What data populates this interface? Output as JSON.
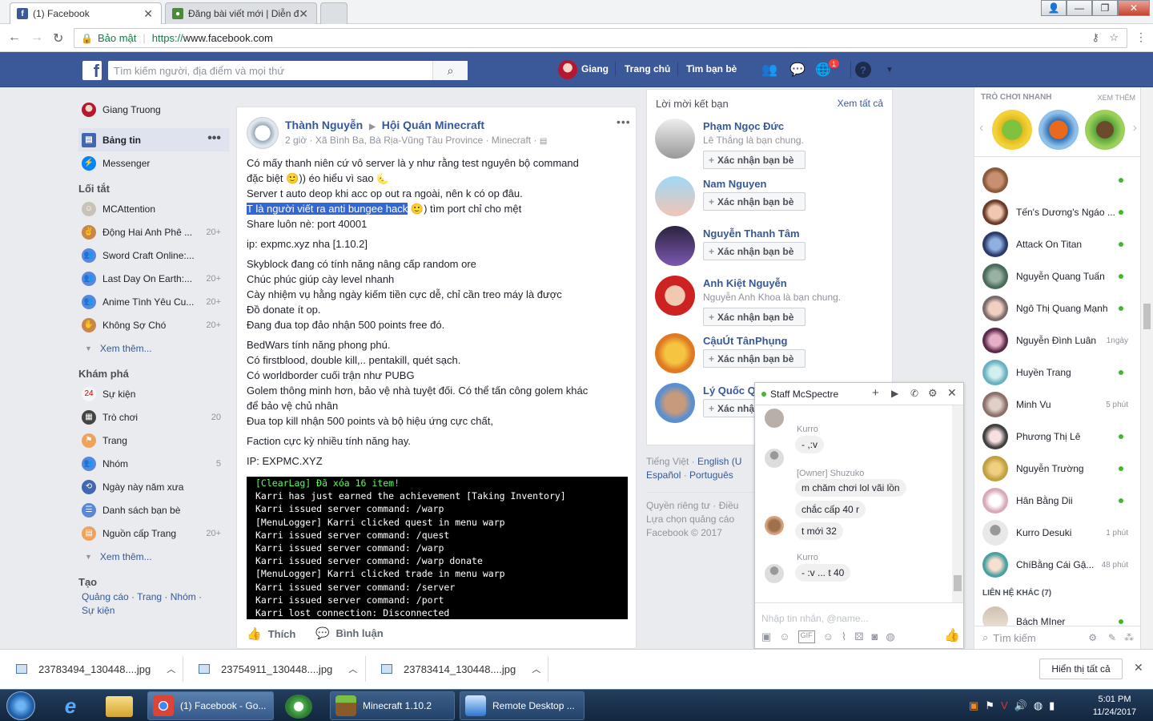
{
  "browser": {
    "tabs": [
      {
        "title": "(1) Facebook"
      },
      {
        "title": "Đăng bài viết mới | Diễn đ"
      }
    ],
    "url": "https://www.facebook.com",
    "url_prefix": "https://",
    "url_host": "www.facebook.com",
    "secure_label": "Bảo mật"
  },
  "fb_header": {
    "search_placeholder": "Tìm kiếm người, địa điểm và mọi thứ",
    "user_name": "Giang",
    "home": "Trang chủ",
    "find_friends": "Tìm bạn bè",
    "notif_count": "1"
  },
  "left_nav": {
    "profile_name": "Giang Truong",
    "news_feed": "Bảng tin",
    "messenger": "Messenger",
    "shortcuts_title": "Lối tắt",
    "shortcuts": [
      {
        "label": "MCAttention",
        "count": ""
      },
      {
        "label": "Động Hai Anh Phê ...",
        "count": "20+"
      },
      {
        "label": "Sword Craft Online:...",
        "count": ""
      },
      {
        "label": "Last Day On Earth:...",
        "count": "20+"
      },
      {
        "label": "Anime Tình Yêu Cu...",
        "count": "20+"
      },
      {
        "label": "Không Sợ Chó",
        "count": "20+"
      }
    ],
    "see_more": "Xem thêm...",
    "explore_title": "Khám phá",
    "explore": [
      {
        "label": "Sự kiện",
        "count": ""
      },
      {
        "label": "Trò chơi",
        "count": "20"
      },
      {
        "label": "Trang",
        "count": ""
      },
      {
        "label": "Nhóm",
        "count": "5"
      },
      {
        "label": "Ngày này năm xưa",
        "count": ""
      },
      {
        "label": "Danh sách bạn bè",
        "count": ""
      },
      {
        "label": "Nguồn cấp Trang",
        "count": "20+"
      }
    ],
    "see_more2": "Xem thêm...",
    "create_title": "Tạo",
    "create_links": [
      "Quảng cáo",
      "Trang",
      "Nhóm",
      "Sự kiện"
    ],
    "link_sep": " · "
  },
  "post": {
    "author": "Thành Nguyễn",
    "group": "Hội Quán Minecraft",
    "meta": "2 giờ · Xã Bình Ba, Bà Rịa-Vũng Tàu Province · Minecraft ·",
    "lines": [
      "Có mấy thanh niên cứ vô server là y như rằng test nguyên bộ command",
      "đặc biệt 🙂)) éo hiểu vì sao 🌜",
      "Server t auto deop khi acc op out ra ngoài, nên k có op đâu.",
      "",
      "Share luôn nè: port 40001",
      "ip: expmc.xyz nha [1.10.2]",
      "Skyblock đang có tính năng nâng cấp random ore",
      "Chúc phúc giúp cày level nhanh",
      "Cày nhiệm vụ hằng ngày kiếm tiền cực dễ, chỉ cần treo máy là được",
      "Đồ donate ít op.",
      "Đang đua top đảo nhận 500 points free đó.",
      "BedWars tính năng phong phú.",
      "Có firstblood, double kill,.. pentakill, quét sạch.",
      "Có worldborder cuối trận như PUBG",
      "Golem thông minh hơn, bảo vệ nhà tuyệt đối. Có thể tấn công golem khác",
      "để bảo vệ chủ nhân",
      "Đua top kill nhận 500 points và bộ hiệu ứng cực chất,",
      "Faction cực kỳ nhiều tính năng hay.",
      "IP: EXPMC.XYZ"
    ],
    "highlight": "T là người viết ra anti bungee hack",
    "highlight_rest": "🙂) tìm port chỉ cho mệt",
    "terminal": [
      {
        "text": "[ClearLag] Đã xóa 16 item!",
        "color": "#55ff55"
      },
      {
        "text": "Karri has just earned the achievement [Taking Inventory]",
        "color": "#ffffff"
      },
      {
        "text": "Karri issued server command: /warp",
        "color": "#ffffff"
      },
      {
        "text": "[MenuLogger] Karri clicked quest in menu warp",
        "color": "#ffffff"
      },
      {
        "text": "Karri issued server command: /quest",
        "color": "#ffffff"
      },
      {
        "text": "Karri issued server command: /warp",
        "color": "#ffffff"
      },
      {
        "text": "Karri issued server command: /warp donate",
        "color": "#ffffff"
      },
      {
        "text": "[MenuLogger] Karri clicked trade in menu warp",
        "color": "#ffffff"
      },
      {
        "text": "Karri issued server command: /server",
        "color": "#ffffff"
      },
      {
        "text": "Karri issued server command: /port",
        "color": "#ffffff"
      },
      {
        "text": "Karri lost connection: Disconnected",
        "color": "#ffffff"
      }
    ],
    "like": "Thích",
    "comment": "Bình luận"
  },
  "friend_requests": {
    "title": "Lời mời kết bạn",
    "see_all": "Xem tất cả",
    "items": [
      {
        "name": "Phạm Ngọc Đức",
        "mutual": "Lê Thắng là bạn chung."
      },
      {
        "name": "Nam Nguyen",
        "mutual": ""
      },
      {
        "name": "Nguyễn Thanh Tâm",
        "mutual": ""
      },
      {
        "name": "Anh Kiệt Nguyễn",
        "mutual": "Nguyễn Anh Khoa là bạn chung."
      },
      {
        "name": "CậuÚt TânPhụng",
        "mutual": ""
      },
      {
        "name": "Lý Quốc Q",
        "mutual": ""
      }
    ],
    "confirm": "Xác nhận bạn bè",
    "confirm_short": "Xác nhậ"
  },
  "footer": {
    "lang1": "Tiếng Việt",
    "lang2": "English (U",
    "lang3": "Español",
    "lang4": "Português",
    "sep": " · ",
    "privacy": "Quyền riêng tư",
    "terms": "Điều",
    "ads": "Lựa chọn quảng cáo",
    "copyright": "Facebook © 2017"
  },
  "right": {
    "games_title": "TRÒ CHƠI NHANH",
    "games_more": "XEM THÊM",
    "contacts": [
      {
        "name": "",
        "status": "online"
      },
      {
        "name": "Tến's Dương's Ngáo ...",
        "status": "online"
      },
      {
        "name": "Attack On Titan",
        "status": "online"
      },
      {
        "name": "Nguyễn Quang Tuấn",
        "status": "online"
      },
      {
        "name": "Ngô Thị Quang Mạnh",
        "status": "online"
      },
      {
        "name": "Nguyễn Đình Luân",
        "status": "1ngày"
      },
      {
        "name": "Huyền Trang",
        "status": "online"
      },
      {
        "name": "Minh Vu",
        "status": "5 phút"
      },
      {
        "name": "Phương Thị Lê",
        "status": "online"
      },
      {
        "name": "Nguyễn Trường",
        "status": "online"
      },
      {
        "name": "Hân Bằng Dii",
        "status": "online"
      },
      {
        "name": "Kurro Desuki",
        "status": "1 phút"
      },
      {
        "name": "ChíBằng Cái Gậ...",
        "status": "48 phút"
      }
    ],
    "other_contacts": "LIÊN HỆ KHÁC (7)",
    "last_contact": "Bách MIner",
    "search": "Tìm kiếm"
  },
  "chat": {
    "name": "Staff McSpectre",
    "messages": [
      {
        "sender": "Kurro",
        "texts": [
          "- ,:v"
        ]
      },
      {
        "sender": "[Owner] Shuzuko",
        "texts": [
          "m chăm chơi lol vãi lồn",
          "chắc cấp 40 r",
          "t mới 32"
        ]
      },
      {
        "sender": "Kurro",
        "texts": [
          "- :v ... t 40"
        ]
      }
    ],
    "input_placeholder": "Nhập tin nhắn, @name..."
  },
  "downloads": {
    "files": [
      "23783494_130448....jpg",
      "23754911_130448....jpg",
      "23783414_130448....jpg"
    ],
    "show_all": "Hiển thị tất cả"
  },
  "taskbar": {
    "tasks": [
      "(1) Facebook - Go...",
      "Minecraft 1.10.2",
      "Remote Desktop ..."
    ],
    "time": "5:01 PM",
    "date": "11/24/2017"
  }
}
